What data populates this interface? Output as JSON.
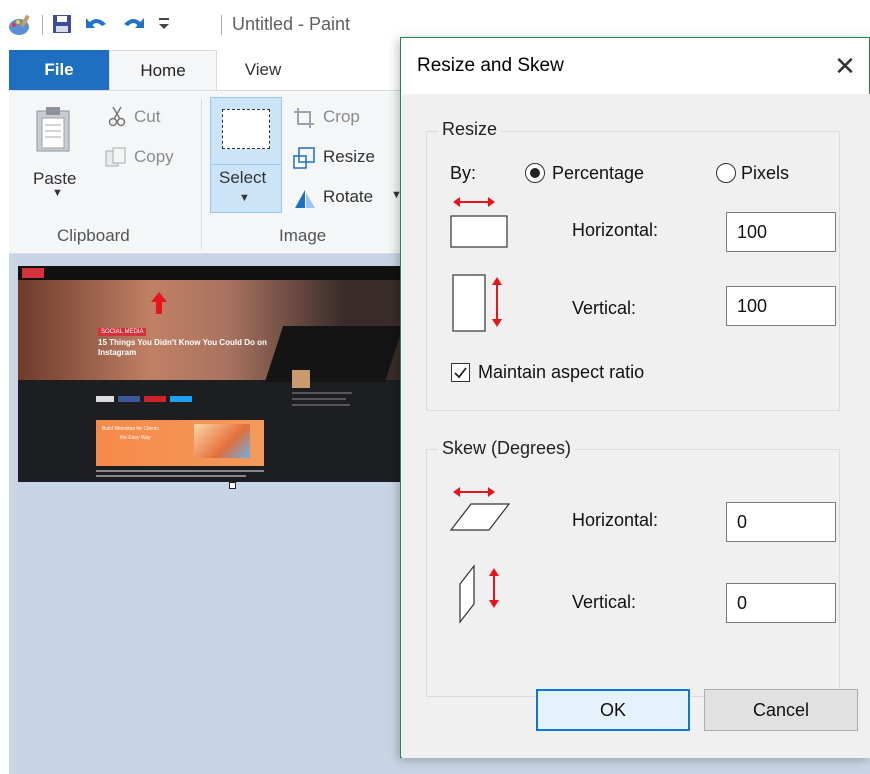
{
  "window": {
    "title": "Untitled - Paint"
  },
  "tabs": {
    "file": "File",
    "home": "Home",
    "view": "View"
  },
  "ribbon": {
    "paste": "Paste",
    "cut": "Cut",
    "copy": "Copy",
    "clipboard_group": "Clipboard",
    "select": "Select",
    "crop": "Crop",
    "resize": "Resize",
    "rotate": "Rotate",
    "image_group": "Image"
  },
  "canvas": {
    "headline": "15 Things You Didn't Know You Could Do on Instagram",
    "tag": "SOCIAL MEDIA",
    "promo_line1": "Build Websites for Clients",
    "promo_line2": "the Easy Way"
  },
  "dialog": {
    "title": "Resize and Skew",
    "resize": {
      "group_title": "Resize",
      "by_label": "By:",
      "percentage_label": "Percentage",
      "pixels_label": "Pixels",
      "selected_unit": "Percentage",
      "horizontal_label": "Horizontal:",
      "horizontal_value": "100",
      "vertical_label": "Vertical:",
      "vertical_value": "100",
      "maintain_label": "Maintain aspect ratio",
      "maintain_checked": true
    },
    "skew": {
      "group_title": "Skew (Degrees)",
      "horizontal_label": "Horizontal:",
      "horizontal_value": "0",
      "vertical_label": "Vertical:",
      "vertical_value": "0"
    },
    "ok_label": "OK",
    "cancel_label": "Cancel"
  },
  "colors": {
    "accent": "#1e6fbf",
    "dialog_border": "#1d8a4a",
    "arrow_red": "#e8141b",
    "selection": "#cce4f7"
  }
}
